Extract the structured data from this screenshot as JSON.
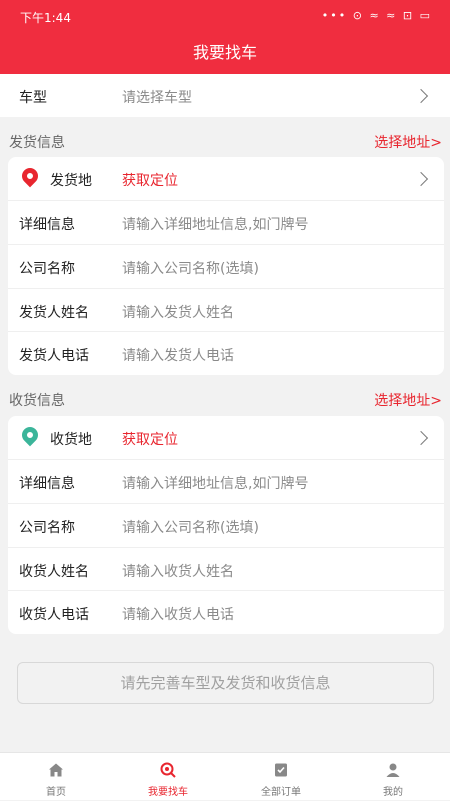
{
  "status_bar": {
    "time": "下午1:44",
    "icons": "••• ⊙ ≈ ≈ ⊡ ▭"
  },
  "header": {
    "title": "我要找车"
  },
  "vehicle": {
    "label": "车型",
    "placeholder": "请选择车型"
  },
  "shipping": {
    "section_title": "发货信息",
    "select_address": "选择地址>",
    "origin_label": "发货地",
    "origin_action": "获取定位",
    "detail_label": "详细信息",
    "detail_placeholder": "请输入详细地址信息,如门牌号",
    "company_label": "公司名称",
    "company_placeholder": "请输入公司名称(选填)",
    "name_label": "发货人姓名",
    "name_placeholder": "请输入发货人姓名",
    "phone_label": "发货人电话",
    "phone_placeholder": "请输入发货人电话"
  },
  "receiving": {
    "section_title": "收货信息",
    "select_address": "选择地址>",
    "dest_label": "收货地",
    "dest_action": "获取定位",
    "detail_label": "详细信息",
    "detail_placeholder": "请输入详细地址信息,如门牌号",
    "company_label": "公司名称",
    "company_placeholder": "请输入公司名称(选填)",
    "name_label": "收货人姓名",
    "name_placeholder": "请输入收货人姓名",
    "phone_label": "收货人电话",
    "phone_placeholder": "请输入收货人电话"
  },
  "submit": {
    "label": "请先完善车型及发货和收货信息"
  },
  "tabs": [
    {
      "label": "首页",
      "icon": "home-icon"
    },
    {
      "label": "我要找车",
      "icon": "search-car-icon",
      "active": true
    },
    {
      "label": "全部订单",
      "icon": "orders-icon"
    },
    {
      "label": "我的",
      "icon": "user-icon"
    }
  ],
  "colors": {
    "brand": "#f02d3f",
    "accent": "#e8262f",
    "origin_pin": "#e8262f",
    "dest_pin": "#3bb59a"
  }
}
